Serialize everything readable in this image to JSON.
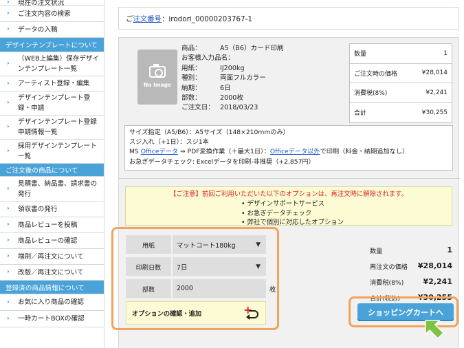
{
  "sidebar": {
    "items": [
      {
        "type": "item",
        "label": "現在の注文状況",
        "h": 9
      },
      {
        "type": "item",
        "label": "ご注文内容の検索",
        "h": 23
      },
      {
        "type": "item",
        "label": "データの入稿",
        "h": 23
      },
      {
        "type": "head",
        "label": "デザインテンプレートについて",
        "h": 21
      },
      {
        "type": "item",
        "label": "（WEB上編集）保存デザインテンプレート一覧",
        "h": 35
      },
      {
        "type": "item",
        "label": "アーティスト登録・編集",
        "h": 22
      },
      {
        "type": "item",
        "label": "デザインテンプレート登録・申請",
        "h": 35
      },
      {
        "type": "item",
        "label": "デザインテンプレート登録申請情報一覧",
        "h": 35
      },
      {
        "type": "item",
        "label": "採用デザインテンプレート一覧",
        "h": 35
      },
      {
        "type": "head",
        "label": "ご注文後の商品について",
        "h": 19
      },
      {
        "type": "item",
        "label": "見積書、納品書、請求書の発行",
        "h": 36
      },
      {
        "type": "item",
        "label": "領収書の発行",
        "h": 23
      },
      {
        "type": "item",
        "label": "商品レビューを投稿",
        "h": 23
      },
      {
        "type": "item",
        "label": "商品レビューの確認",
        "h": 23
      },
      {
        "type": "item",
        "label": "増刷／再注文について",
        "h": 23
      },
      {
        "type": "item",
        "label": "改版／再注文について",
        "h": 23
      },
      {
        "type": "head",
        "label": "登録済の商品情報について",
        "h": 20
      },
      {
        "type": "item",
        "label": "お気に入り商品の確認",
        "h": 24
      },
      {
        "type": "item",
        "label": "一時カートBOXの確認",
        "h": 24
      }
    ]
  },
  "order": {
    "prefix": "ご",
    "link_text": "注文番号",
    "suffix": "：irodori_00000203767-1"
  },
  "product": {
    "no_image_label": "No Image",
    "spec": [
      {
        "k": "商品：",
        "v": "A5（B6）カード印刷"
      },
      {
        "k": "お客様入力品名：",
        "v": ""
      },
      {
        "k": "用紙：",
        "v": "IJ200kg"
      },
      {
        "k": "種別：",
        "v": "両面フルカラー"
      },
      {
        "k": "納期：",
        "v": "6日"
      },
      {
        "k": "部数：",
        "v": "2000枚"
      },
      {
        "k": "ご注文日：",
        "v": "2018/03/23"
      }
    ]
  },
  "prices": [
    {
      "label": "数量",
      "value": "1"
    },
    {
      "label": "ご注文時の価格",
      "value": "¥28,014"
    },
    {
      "label": "消費税(8%)",
      "value": "¥2,241"
    },
    {
      "label": "合計",
      "value": "¥30,255"
    }
  ],
  "notes": {
    "line1": "サイズ指定（A5/B6）：A5サイズ（148×210mmのみ）",
    "line2": "スジ入れ（+1日）：スジ1本",
    "line3_pre": "MS ",
    "line3_link1": "Officeデータ",
    "line3_mid": " ⇒ PDF変換作業（＋最大1日）：",
    "line3_link2": "Officeデータ以外",
    "line3_post": "で印刷（料金・納期追加なし）",
    "line4": "お急ぎデータチェック: Excelデータを印刷-非推奨（+2,857円）"
  },
  "notice": {
    "title": "【ご注意】前回ご利用いただいた以下のオプションは、再注文時に解除されます。",
    "items": [
      "デザインサポートサービス",
      "お急ぎデータチェック",
      "弊社で個別に対応したオプション"
    ]
  },
  "options": {
    "paper_label": "用紙",
    "paper_value": "マットコート180kg",
    "days_label": "印刷日数",
    "days_value": "7日",
    "qty_label": "部数",
    "qty_value": "2000",
    "qty_unit": "枚",
    "add_label": "オプションの確認・追加"
  },
  "summary": [
    {
      "label": "数量",
      "value": "1"
    },
    {
      "label": "再注文の価格",
      "value": "¥28,014"
    },
    {
      "label": "消費税(8%)",
      "value": "¥2,241"
    },
    {
      "label": "合計(税込)",
      "value": "¥30,255"
    }
  ],
  "cart_button": "ショッピングカートへ",
  "colors": {
    "accent": "#4aa3d8",
    "highlight": "#f0a35b",
    "pointer": "#7dc242",
    "warning": "#e02020"
  }
}
